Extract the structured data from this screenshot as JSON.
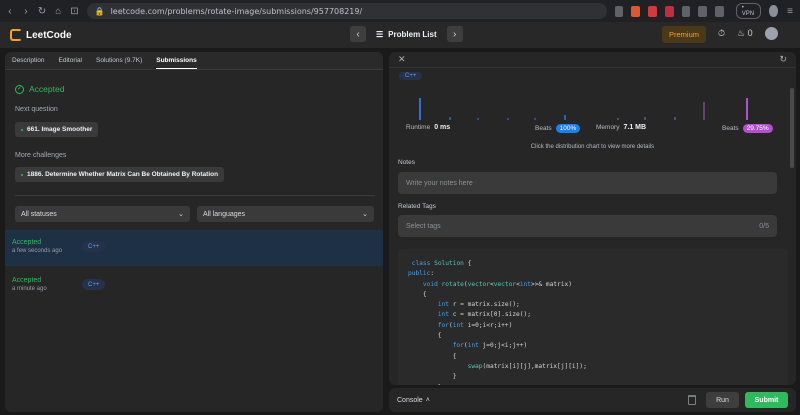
{
  "browser": {
    "url": "leetcode.com/problems/rotate-image/submissions/957708219/",
    "vpn_label": "• VPN"
  },
  "nav": {
    "logo_text": "LeetCode",
    "problem_list": "Problem List",
    "premium": "Premium",
    "streak": "0"
  },
  "left": {
    "tabs": [
      {
        "label": "Description"
      },
      {
        "label": "Editorial"
      },
      {
        "label": "Solutions (9.7K)"
      },
      {
        "label": "Submissions"
      }
    ],
    "status_title": "Accepted",
    "next_question_label": "Next question",
    "next_question": "661. Image Smoother",
    "more_challenges_label": "More challenges",
    "more_challenge": "1886. Determine Whether Matrix Can Be Obtained By Rotation",
    "filter_status": "All statuses",
    "filter_language": "All languages",
    "submissions": [
      {
        "status": "Accepted",
        "time": "a few seconds ago",
        "lang": "C++"
      },
      {
        "status": "Accepted",
        "time": "a minute ago",
        "lang": "C++"
      }
    ]
  },
  "right": {
    "lang": "C++",
    "runtime_label": "Runtime",
    "runtime_value": "0 ms",
    "beats_label": "Beats",
    "runtime_beats": "100%",
    "memory_label": "Memory",
    "memory_value": "7.1 MB",
    "memory_beats": "29.75%",
    "hint": "Click the distribution chart to view more details",
    "notes_label": "Notes",
    "notes_placeholder": "Write your notes here",
    "tags_label": "Related Tags",
    "tags_placeholder": "Select tags",
    "tags_count": "0/5",
    "code_lines": [
      " class Solution {",
      "public:",
      "    void rotate(vector<vector<int>>& matrix)",
      "    {",
      "        int r = matrix.size();",
      "        int c = matrix[0].size();",
      "        for(int i=0;i<r;i++)",
      "        {",
      "            for(int j=0;j<i;j++)",
      "            {",
      "                swap(matrix[i][j],matrix[j][i]);",
      "            }",
      "        }"
    ]
  },
  "console": {
    "label": "Console",
    "run": "Run",
    "submit": "Submit"
  },
  "colors": {
    "accepted": "#2cbb5d",
    "runtime_pill": "#1a7ef5",
    "memory_pill": "#b44ed3",
    "accent": "#ffa116"
  }
}
